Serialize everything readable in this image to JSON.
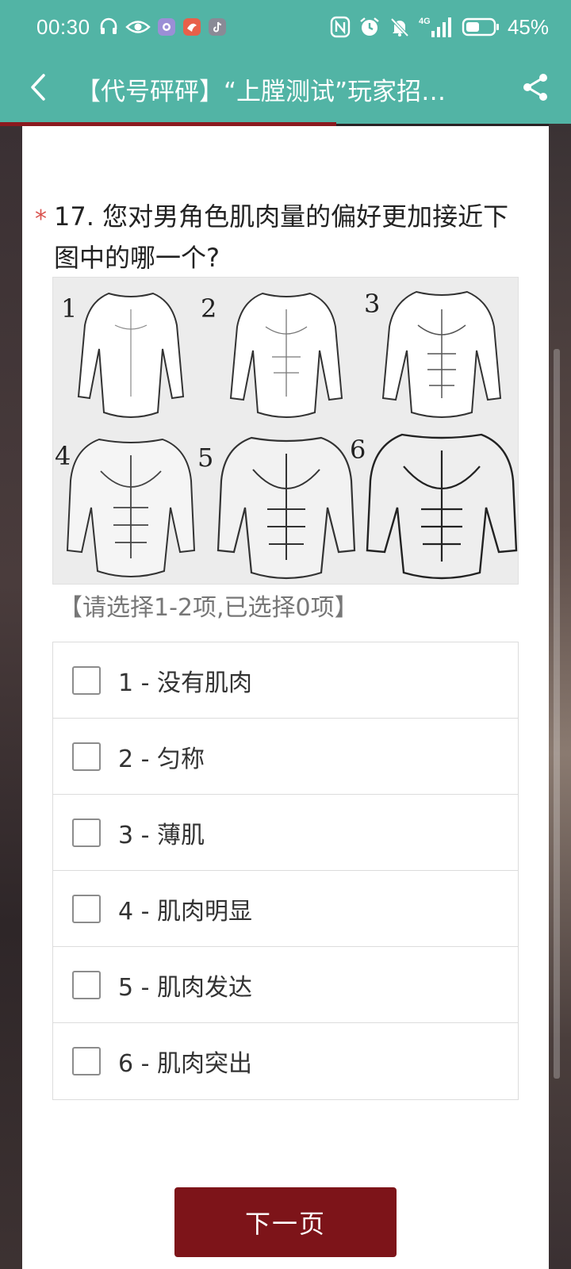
{
  "statusbar": {
    "time": "00:30",
    "network": "4G",
    "battery": "45%"
  },
  "appbar": {
    "title": "【代号砰砰】“上膛测试”玩家招…"
  },
  "question": {
    "required_mark": "*",
    "text": "17. 您对男角色肌肉量的偏好更加接近下图中的哪一个?",
    "figure_labels": [
      "1",
      "2",
      "3",
      "4",
      "5",
      "6"
    ],
    "hint": "【请选择1-2项,已选择0项】"
  },
  "options": [
    {
      "label": "1 - 没有肌肉",
      "checked": false
    },
    {
      "label": "2 - 匀称",
      "checked": false
    },
    {
      "label": "3 - 薄肌",
      "checked": false
    },
    {
      "label": "4 - 肌肉明显",
      "checked": false
    },
    {
      "label": "5 - 肌肉发达",
      "checked": false
    },
    {
      "label": "6 - 肌肉突出",
      "checked": false
    }
  ],
  "footer": {
    "next_label": "下一页"
  },
  "colors": {
    "header": "#52b4a5",
    "accent": "#7d1419",
    "required": "#d9534f"
  },
  "icons": [
    "headphones-icon",
    "eye-icon",
    "app-icon",
    "app-icon",
    "tiktok-icon",
    "nfc-icon",
    "alarm-icon",
    "mute-icon",
    "signal-icon",
    "battery-icon",
    "back-icon",
    "share-icon"
  ]
}
